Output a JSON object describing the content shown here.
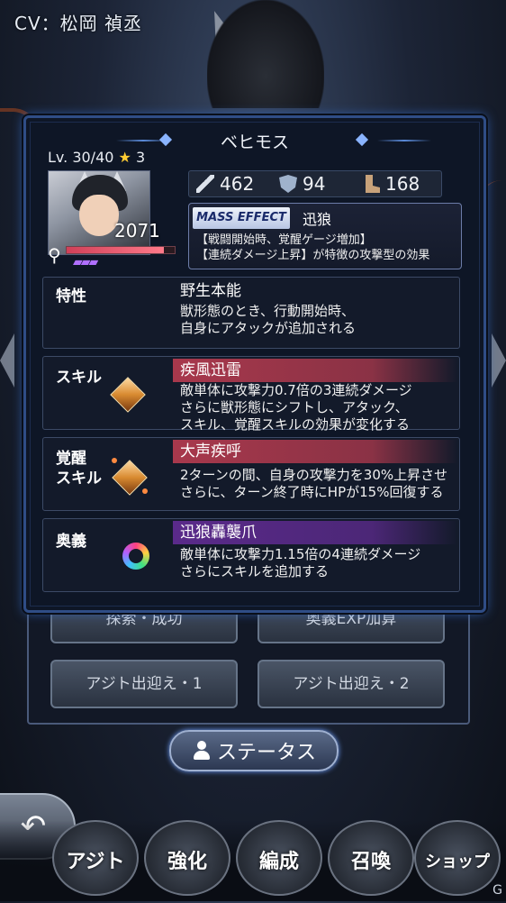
{
  "cv_label": "CV：松岡 禎丞",
  "character": {
    "name": "ベヒモス",
    "level": "Lv. 30/40",
    "stars": "3",
    "power": "2071",
    "hp_fraction": 0.9,
    "stats": {
      "attack": "462",
      "defense": "94",
      "speed": "168"
    }
  },
  "mass_effect": {
    "badge": "MASS EFFECT",
    "name": "迅狼",
    "description": "【戦闘開始時、覚醒ゲージ増加】\n【連続ダメージ上昇】が特徴の攻撃型の効果"
  },
  "sections": {
    "trait": {
      "label": "特性",
      "name": "野生本能",
      "description": "獣形態のとき、行動開始時、\n自身にアタックが追加される"
    },
    "skill": {
      "label": "スキル",
      "name": "疾風迅雷",
      "description": "敵単体に攻撃力0.7倍の3連続ダメージ\nさらに獣形態にシフトし、アタック、\nスキル、覚醒スキルの効果が変化する",
      "bar_color": "#a8384c"
    },
    "awaken": {
      "label": "覚醒\nスキル",
      "name": "大声疾呼",
      "description": "2ターンの間、自身の攻撃力を30%上昇させ\nさらに、ターン終了時にHPが15%回復する",
      "bar_color": "#a8384c"
    },
    "ougi": {
      "label": "奥義",
      "name": "迅狼轟襲爪",
      "description": "敵単体に攻撃力1.15倍の4連続ダメージ\nさらにスキルを追加する",
      "bar_color": "#5a2a8a"
    }
  },
  "under_buttons": [
    "探索・成功",
    "奥義EXP加算",
    "アジト出迎え・1",
    "アジト出迎え・2"
  ],
  "status_button": "ステータス",
  "nav": [
    "アジト",
    "強化",
    "編成",
    "召喚",
    "ショップ"
  ],
  "back_icon": "↶",
  "watermark": "G"
}
